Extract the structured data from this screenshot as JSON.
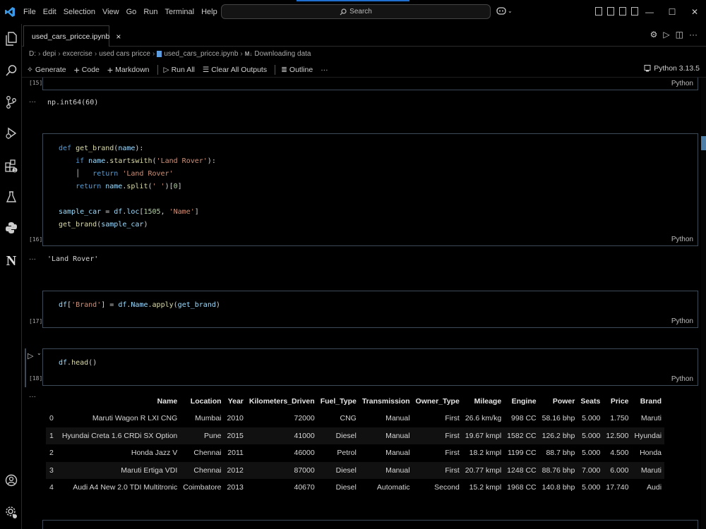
{
  "menu": [
    "File",
    "Edit",
    "Selection",
    "View",
    "Go",
    "Run",
    "Terminal",
    "Help"
  ],
  "search": {
    "label": "Search"
  },
  "tab": {
    "title": "used_cars_pricce.ipynb",
    "close": "×"
  },
  "breadcrumb": [
    "D:",
    "depi",
    "excercise",
    "used cars pricce",
    "used_cars_pricce.ipynb",
    "Downloading data"
  ],
  "breadcrumb_md": "M↓",
  "toolbar": {
    "generate": "Generate",
    "code": "Code",
    "markdown": "Markdown",
    "run_all": "Run All",
    "clear_outputs": "Clear All Outputs",
    "outline": "Outline",
    "more": "···",
    "kernel": "Python 3.13.5"
  },
  "cells": {
    "c15": {
      "exec": "[15]",
      "lang": "Python",
      "output": "np.int64(60)"
    },
    "c16": {
      "exec": "[16]",
      "lang": "Python",
      "lines": [
        "def get_brand(name):",
        "    if name.startswith('Land Rover'):",
        "        return 'Land Rover'",
        "    return name.split(' ')[0]",
        "",
        "sample_car = df.loc[1505, 'Name']",
        "get_brand(sample_car)"
      ],
      "output": "'Land Rover'"
    },
    "c17": {
      "exec": "[17]",
      "lang": "Python",
      "code": "df['Brand'] = df.Name.apply(get_brand)"
    },
    "c18": {
      "exec": "[18]",
      "lang": "Python",
      "code": "df.head()"
    },
    "output_dots": "···"
  },
  "dataframe": {
    "columns": [
      "",
      "Name",
      "Location",
      "Year",
      "Kilometers_Driven",
      "Fuel_Type",
      "Transmission",
      "Owner_Type",
      "Mileage",
      "Engine",
      "Power",
      "Seats",
      "Price",
      "Brand"
    ],
    "rows": [
      [
        "0",
        "Maruti Wagon R LXI CNG",
        "Mumbai",
        "2010",
        "72000",
        "CNG",
        "Manual",
        "First",
        "26.6 km/kg",
        "998 CC",
        "58.16 bhp",
        "5.000",
        "1.750",
        "Maruti"
      ],
      [
        "1",
        "Hyundai Creta 1.6 CRDi SX Option",
        "Pune",
        "2015",
        "41000",
        "Diesel",
        "Manual",
        "First",
        "19.67 kmpl",
        "1582 CC",
        "126.2 bhp",
        "5.000",
        "12.500",
        "Hyundai"
      ],
      [
        "2",
        "Honda Jazz V",
        "Chennai",
        "2011",
        "46000",
        "Petrol",
        "Manual",
        "First",
        "18.2 kmpl",
        "1199 CC",
        "88.7 bhp",
        "5.000",
        "4.500",
        "Honda"
      ],
      [
        "3",
        "Maruti Ertiga VDI",
        "Chennai",
        "2012",
        "87000",
        "Diesel",
        "Manual",
        "First",
        "20.77 kmpl",
        "1248 CC",
        "88.76 bhp",
        "7.000",
        "6.000",
        "Maruti"
      ],
      [
        "4",
        "Audi A4 New 2.0 TDI Multitronic",
        "Coimbatore",
        "2013",
        "40670",
        "Diesel",
        "Automatic",
        "Second",
        "15.2 kmpl",
        "1968 CC",
        "140.8 bhp",
        "5.000",
        "17.740",
        "Audi"
      ]
    ]
  },
  "colors": {
    "accent": "#1f6fd1",
    "cell_border": "#3d4a57",
    "keyword": "#569cd6",
    "string": "#ce9178"
  }
}
